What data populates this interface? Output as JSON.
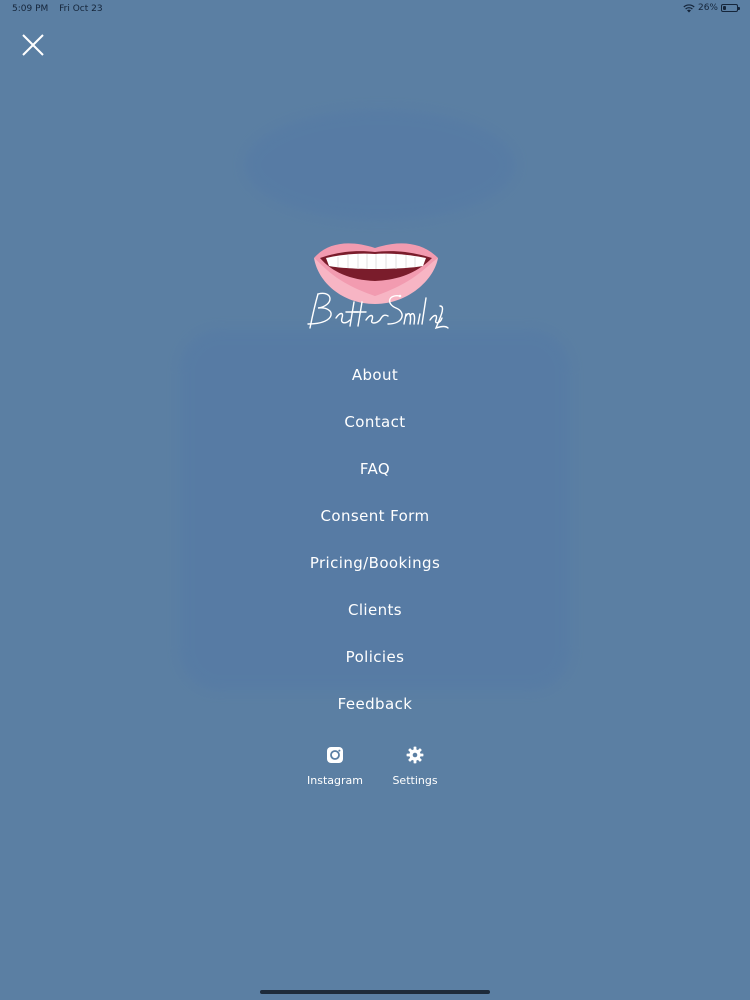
{
  "status_bar": {
    "time": "5:09 PM",
    "date": "Fri Oct 23",
    "battery": "26%",
    "battery_level": 0.26
  },
  "brand": {
    "logo_text": "BetterSmilez"
  },
  "menu": {
    "items": [
      {
        "label": "About"
      },
      {
        "label": "Contact"
      },
      {
        "label": "FAQ"
      },
      {
        "label": "Consent Form"
      },
      {
        "label": "Pricing/Bookings"
      },
      {
        "label": "Clients"
      },
      {
        "label": "Policies"
      },
      {
        "label": "Feedback"
      }
    ]
  },
  "actions": {
    "instagram": {
      "label": "Instagram",
      "icon": "instagram-icon"
    },
    "settings": {
      "label": "Settings",
      "icon": "gear-icon"
    }
  },
  "colors": {
    "overlay": "#5b7fa3",
    "text": "#ffffff",
    "lips": "#f29bb0",
    "status_text": "#15253a"
  }
}
